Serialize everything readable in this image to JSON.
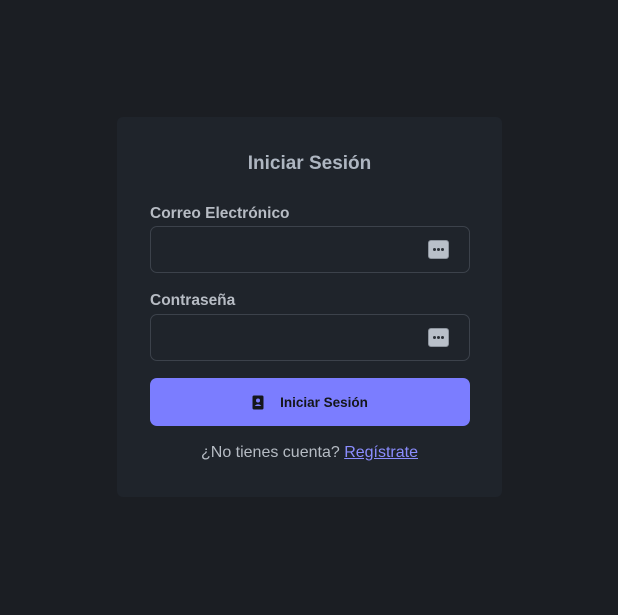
{
  "login": {
    "title": "Iniciar Sesión",
    "email_label": "Correo Electrónico",
    "email_value": "",
    "password_label": "Contraseña",
    "password_value": "",
    "submit_label": "Iniciar Sesión",
    "submit_icon": "contact-card-icon",
    "footer_text": "¿No tienes cuenta?",
    "register_link": "Regístrate"
  },
  "colors": {
    "background": "#1b1e23",
    "card": "#1f242b",
    "accent": "#7b7dff",
    "link": "#8b8dff"
  }
}
